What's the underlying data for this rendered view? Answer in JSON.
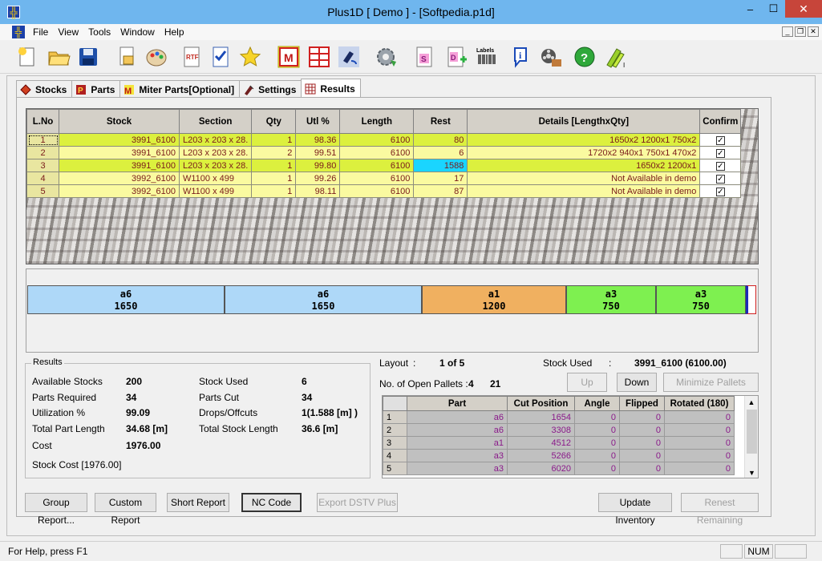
{
  "window": {
    "title": "Plus1D [ Demo ] - [Softpedia.p1d]",
    "minimize": "–",
    "maximize": "☐",
    "close": "✕"
  },
  "menu": [
    "File",
    "View",
    "Tools",
    "Window",
    "Help"
  ],
  "toolbar_icons": [
    "new-icon",
    "open-icon",
    "save-icon",
    "print-preview-icon",
    "palette-icon",
    "rtf-icon",
    "checklist-icon",
    "star-icon",
    "miter-icon",
    "grid-icon",
    "paint-icon",
    "settings-gear-icon",
    "s-doc-icon",
    "d-doc-icon",
    "labels-icon",
    "info-icon",
    "film-icon",
    "help-icon",
    "optimize-icon"
  ],
  "toolbar_labels_text": "Labels",
  "tabs": [
    {
      "label": "Stocks",
      "icon": "stocks-icon"
    },
    {
      "label": "Parts",
      "icon": "parts-icon"
    },
    {
      "label": "Miter Parts[Optional]",
      "icon": "miter-parts-icon"
    },
    {
      "label": "Settings",
      "icon": "settings-icon"
    },
    {
      "label": "Results",
      "icon": "results-icon"
    }
  ],
  "results_table": {
    "headers": [
      "L.No",
      "Stock",
      "Section",
      "Qty",
      "Utl %",
      "Length",
      "Rest",
      "Details [LengthxQty]",
      "Confirm"
    ],
    "rows": [
      {
        "lno": "1",
        "stock": "3991_6100",
        "section": "L203 x 203 x 28.",
        "qty": "1",
        "utl": "98.36",
        "length": "6100",
        "rest": "80",
        "details": "1650x2   1200x1   750x2",
        "confirm": "✓"
      },
      {
        "lno": "2",
        "stock": "3991_6100",
        "section": "L203 x 203 x 28.",
        "qty": "2",
        "utl": "99.51",
        "length": "6100",
        "rest": "6",
        "details": "1720x2   940x1   750x1   470x2",
        "confirm": "✓"
      },
      {
        "lno": "3",
        "stock": "3991_6100",
        "section": "L203 x 203 x 28.",
        "qty": "1",
        "utl": "99.80",
        "length": "6100",
        "rest": "1588",
        "details": "1650x2   1200x1",
        "confirm": "✓"
      },
      {
        "lno": "4",
        "stock": "3992_6100",
        "section": "W1100 x 499",
        "qty": "1",
        "utl": "99.26",
        "length": "6100",
        "rest": "17",
        "details": "Not Available in demo",
        "confirm": "✓"
      },
      {
        "lno": "5",
        "stock": "3992_6100",
        "section": "W1100 x 499",
        "qty": "1",
        "utl": "98.11",
        "length": "6100",
        "rest": "87",
        "details": "Not Available in demo",
        "confirm": "✓"
      }
    ]
  },
  "cut_layout": [
    {
      "part": "a6",
      "length": "1650",
      "color": "#aed8f8"
    },
    {
      "part": "a6",
      "length": "1650",
      "color": "#aed8f8"
    },
    {
      "part": "a1",
      "length": "1200",
      "color": "#f0b060"
    },
    {
      "part": "a3",
      "length": "750",
      "color": "#7ef050"
    },
    {
      "part": "a3",
      "length": "750",
      "color": "#7ef050"
    }
  ],
  "summary": {
    "legend": "Results",
    "available_stocks_label": "Available Stocks",
    "available_stocks": "200",
    "parts_required_label": "Parts Required",
    "parts_required": "34",
    "utilization_label": "Utilization %",
    "utilization": "99.09",
    "total_part_length_label": "Total Part Length",
    "total_part_length": "34.68 [m]",
    "cost_label": "Cost",
    "cost": "1976.00",
    "stock_cost": "Stock Cost [1976.00]",
    "stock_used_label": "Stock Used",
    "stock_used": "6",
    "parts_cut_label": "Parts Cut",
    "parts_cut": "34",
    "drops_label": "Drops/Offcuts",
    "drops": "1(1.588 [m] )",
    "total_stock_length_label": "Total Stock Length",
    "total_stock_length": "36.6 [m]"
  },
  "layout_info": {
    "layout_label": "Layout",
    "layout_sep": ":",
    "layout_value": "1 of 5",
    "stock_used_label": "Stock Used",
    "stock_used_sep": ":",
    "stock_used_value": "3991_6100 (6100.00)",
    "pallets_label": "No. of Open Pallets :",
    "pallets_a": "4",
    "pallets_b": "21"
  },
  "nav_buttons": {
    "up": "Up",
    "down": "Down",
    "minimize": "Minimize Pallets"
  },
  "parts_table": {
    "headers": [
      "Part",
      "Cut Position",
      "Angle",
      "Flipped",
      "Rotated (180)"
    ],
    "rows": [
      {
        "n": "1",
        "part": "a6",
        "pos": "1654",
        "angle": "0",
        "flipped": "0",
        "rotated": "0"
      },
      {
        "n": "2",
        "part": "a6",
        "pos": "3308",
        "angle": "0",
        "flipped": "0",
        "rotated": "0"
      },
      {
        "n": "3",
        "part": "a1",
        "pos": "4512",
        "angle": "0",
        "flipped": "0",
        "rotated": "0"
      },
      {
        "n": "4",
        "part": "a3",
        "pos": "5266",
        "angle": "0",
        "flipped": "0",
        "rotated": "0"
      },
      {
        "n": "5",
        "part": "a3",
        "pos": "6020",
        "angle": "0",
        "flipped": "0",
        "rotated": "0"
      }
    ]
  },
  "bottom_buttons": {
    "group_report": "Group Report...",
    "custom_report": "Custom Report",
    "short_report": "Short Report",
    "nc_code": "NC Code",
    "export_dstv": "Export DSTV Plus",
    "update_inventory": "Update Inventory",
    "renest_remaining": "Renest Remaining"
  },
  "status": {
    "help": "For Help, press F1",
    "num": "NUM"
  }
}
